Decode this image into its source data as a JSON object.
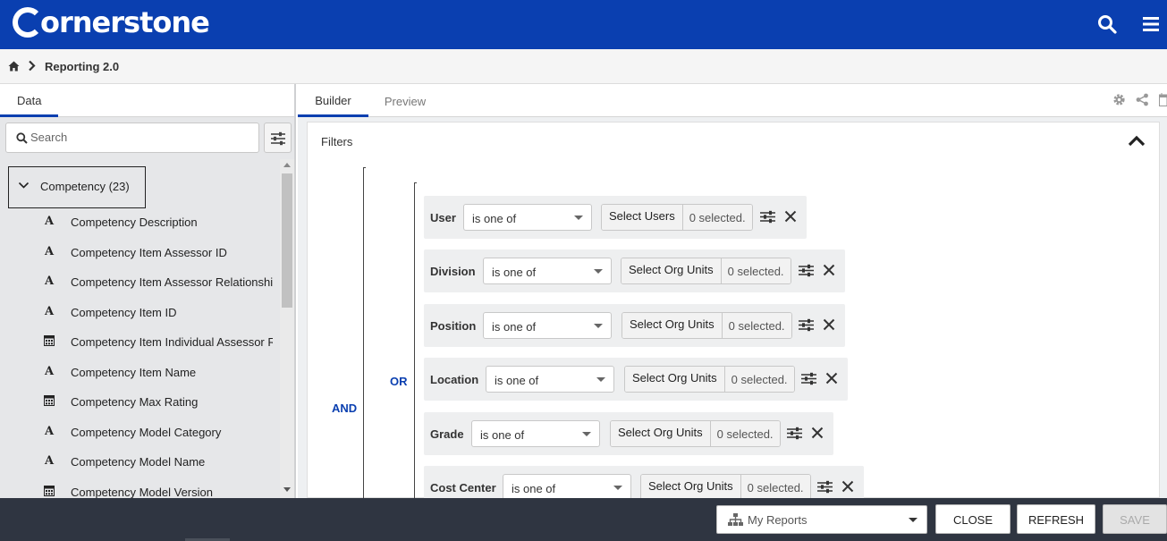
{
  "app": {
    "logo_text": "ornerstone"
  },
  "breadcrumb": {
    "title": "Reporting 2.0"
  },
  "left_panel": {
    "tab_label": "Data",
    "search_placeholder": "Search",
    "category": {
      "label": "Competency (23)"
    },
    "fields": [
      {
        "type": "text",
        "label": "Competency Description"
      },
      {
        "type": "text",
        "label": "Competency Item Assessor ID"
      },
      {
        "type": "text",
        "label": "Competency Item Assessor Relationship"
      },
      {
        "type": "text",
        "label": "Competency Item ID"
      },
      {
        "type": "number",
        "label": "Competency Item Individual Assessor Rating"
      },
      {
        "type": "text",
        "label": "Competency Item Name"
      },
      {
        "type": "number",
        "label": "Competency Max Rating"
      },
      {
        "type": "text",
        "label": "Competency Model Category"
      },
      {
        "type": "text",
        "label": "Competency Model Name"
      },
      {
        "type": "number",
        "label": "Competency Model Version"
      }
    ],
    "text_type_glyph": "A"
  },
  "right_tabs": {
    "builder": "Builder",
    "preview": "Preview"
  },
  "filters": {
    "title": "Filters",
    "and_label": "AND",
    "or_label": "OR",
    "rows": [
      {
        "label": "User",
        "operator": "is one of",
        "select_label": "Select Users",
        "count_text": "0 selected."
      },
      {
        "label": "Division",
        "operator": "is one of",
        "select_label": "Select Org Units",
        "count_text": "0 selected."
      },
      {
        "label": "Position",
        "operator": "is one of",
        "select_label": "Select Org Units",
        "count_text": "0 selected."
      },
      {
        "label": "Location",
        "operator": "is one of",
        "select_label": "Select Org Units",
        "count_text": "0 selected."
      },
      {
        "label": "Grade",
        "operator": "is one of",
        "select_label": "Select Org Units",
        "count_text": "0 selected."
      },
      {
        "label": "Cost Center",
        "operator": "is one of",
        "select_label": "Select Org Units",
        "count_text": "0 selected."
      }
    ]
  },
  "footer": {
    "folder_select": "My Reports",
    "close_label": "CLOSE",
    "refresh_label": "REFRESH",
    "save_label": "SAVE"
  },
  "colors": {
    "brand": "#0a3fb0",
    "footer": "#2f3541",
    "panel": "#e6e7e9"
  }
}
